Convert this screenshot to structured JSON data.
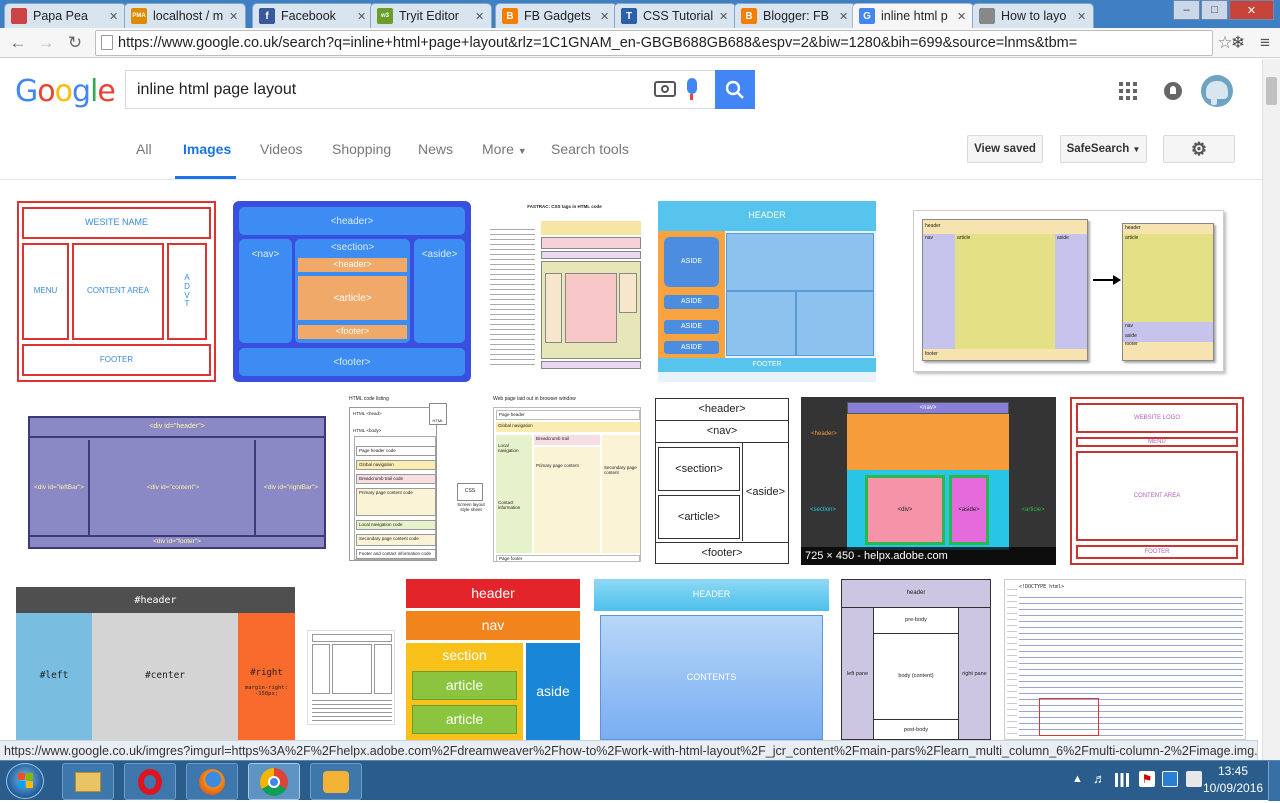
{
  "browser": {
    "tabs": [
      {
        "title": "Papa Pea",
        "color": "#c44"
      },
      {
        "title": "localhost / m",
        "color": "#e08a00",
        "icon_text": "PMA"
      },
      {
        "title": "Facebook",
        "color": "#3b5998",
        "icon_text": "f"
      },
      {
        "title": "Tryit Editor",
        "color": "#6a9d2a",
        "icon_text": "w3"
      },
      {
        "title": "FB Gadgets",
        "color": "#f57d00",
        "icon_text": "B"
      },
      {
        "title": "CSS Tutorial",
        "color": "#2b5fa8",
        "icon_text": "T"
      },
      {
        "title": "Blogger: FB",
        "color": "#f57d00",
        "icon_text": "B"
      },
      {
        "title": "inline html p",
        "color": "#4285f4",
        "icon_text": "G",
        "active": true
      },
      {
        "title": "How to layo",
        "color": "#888",
        "icon_text": ""
      }
    ],
    "url": "https://www.google.co.uk/search?q=inline+html+page+layout&rlz=1C1GNAM_en-GBGB688GB688&espv=2&biw=1280&bih=699&source=lnms&tbm=",
    "status_url": "https://www.google.co.uk/imgres?imgurl=https%3A%2F%2Fhelpx.adobe.com%2Fdreamweaver%2Fhow-to%2Fwork-with-html-layout%2F_jcr_content%2Fmain-pars%2Flearn_multi_column_6%2Fmulti-column-2%2Fimage.img.jpg%2Fht..."
  },
  "google": {
    "logo": "Google",
    "query": "inline html page layout",
    "tabs": [
      "All",
      "Images",
      "Videos",
      "Shopping",
      "News",
      "More",
      "Search tools"
    ],
    "view_saved": "View saved",
    "safesearch": "SafeSearch"
  },
  "thumbs": {
    "t1": {
      "website": "WESITE NAME",
      "menu": "MENU",
      "content": "CONTENT AREA",
      "advt": "A D V T",
      "footer": "FOOTER"
    },
    "t2": {
      "header": "<header>",
      "nav": "<nav>",
      "section": "<section>",
      "aside": "<aside>",
      "inner_header": "<header>",
      "article": "<article>",
      "inner_footer": "<footer>",
      "footer": "<footer>"
    },
    "t3": {
      "title": "FASTRAC: CSS tags in HTML code"
    },
    "t4": {
      "header": "HEADER",
      "aside1": "ASIDE",
      "aside2": "ASIDE",
      "aside3": "ASIDE",
      "aside4": "ASIDE",
      "footer": "FOOTER"
    },
    "t5": {
      "header": "header",
      "nav": "nav",
      "article": "article",
      "aside": "aside",
      "footer": "footer",
      "header2": "header",
      "article2": "article",
      "nav2": "nav",
      "aside2": "aside",
      "footer2": "footer"
    },
    "t6": {
      "header": "<div id=\"header\">",
      "left": "<div id=\"leftBar\">",
      "content": "<div id=\"content\">",
      "right": "<div id=\"rightBar\">",
      "footer": "<div id=\"footer\">"
    },
    "t7": {
      "left_title": "HTML code listing",
      "right_title": "Web page laid out in browser window",
      "head": "HTML <head>",
      "body": "HTML <body>",
      "page_header": "Page header code",
      "global_nav": "Global navigation",
      "breadcrumb": "Breadcrumb trail code",
      "primary": "Primary page content code",
      "local_nav": "Local navigation code",
      "secondary": "Secondary page content code",
      "footer": "Footer and contact information code",
      "css": "CSS",
      "css_sheet": "Screen layout style sheet",
      "w_header": "Page header",
      "w_global": "Global navigation",
      "w_local": "Local navigation",
      "w_bread": "Breadcrumb trail",
      "w_primary": "Primary page content",
      "w_secondary": "Secondary page content",
      "w_contact": "Contact information",
      "w_footer": "Page footer",
      "html": "HTML"
    },
    "t8": {
      "header": "<header>",
      "nav": "<nav>",
      "section": "<section>",
      "article": "<article>",
      "aside": "<aside>",
      "footer": "<footer>"
    },
    "t9": {
      "nav": "<nav>",
      "header": "<header>",
      "section": "<section>",
      "div": "<div>",
      "aside": "<aside>",
      "article": "<article>",
      "caption": "725 × 450 - helpx.adobe.com"
    },
    "t10": {
      "logo": "WEBSITE LOGO",
      "menu": "MENU",
      "content": "CONTENT AREA",
      "footer": "FOOTER"
    },
    "t11": {
      "header": "#header",
      "left": "#left",
      "center": "#center",
      "right": "#right",
      "margin": "margin-right: -150px;"
    },
    "t13": {
      "header": "header",
      "nav": "nav",
      "section": "section",
      "article1": "article",
      "article2": "article",
      "aside": "aside"
    },
    "t14": {
      "header": "HEADER",
      "contents": "CONTENTS"
    },
    "t15": {
      "header": "header",
      "pre": "pre-body",
      "left": "left pane",
      "body": "body (content)",
      "right": "right pane",
      "post": "post-body"
    },
    "t16": {
      "code": "<!DOCTYPE html>"
    }
  },
  "taskbar": {
    "time": "13:45",
    "date": "10/09/2016"
  }
}
